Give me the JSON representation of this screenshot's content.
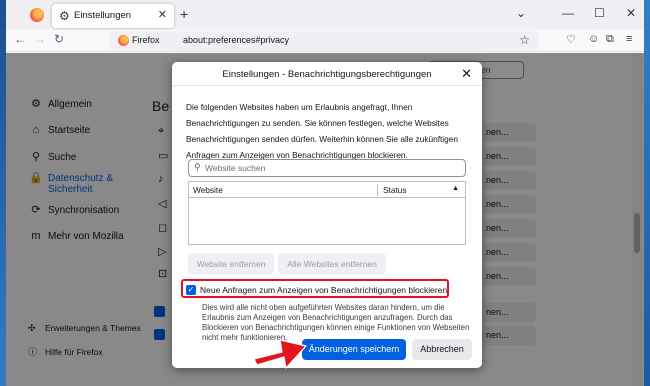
{
  "browser": {
    "tab_title": "Einstellungen",
    "new_tab_glyph": "+",
    "brand_label": "Firefox",
    "address": "about:preferences#privacy"
  },
  "preferences": {
    "search_placeholder": "chen",
    "heading_partial": "Be",
    "sidebar": [
      {
        "label": "Allgemein",
        "icon": "gear-icon"
      },
      {
        "label": "Startseite",
        "icon": "home-icon"
      },
      {
        "label": "Suche",
        "icon": "search-icon"
      },
      {
        "label": "Datenschutz &",
        "label2": "Sicherheit",
        "icon": "lock-icon",
        "active": true
      },
      {
        "label": "Synchronisation",
        "icon": "sync-icon"
      },
      {
        "label": "Mehr von Mozilla",
        "icon": "mozilla-icon"
      }
    ],
    "footer": [
      {
        "label": "Erweiterungen & Themes",
        "icon": "puzzle-icon"
      },
      {
        "label": "Hilfe für Firefox",
        "icon": "help-icon"
      }
    ],
    "row_button_partial": "nen..."
  },
  "dialog": {
    "title": "Einstellungen - Benachrichtigungsberechtigungen",
    "description": "Die folgenden Websites haben um Erlaubnis angefragt, Ihnen Benachrichtigungen zu senden. Sie können festlegen, welche Websites Benachrichtigungen senden dürfen. Weiterhin können Sie alle zukünftigen Anfragen zum Anzeigen von Benachrichtigungen blockieren.",
    "search_placeholder": "Website suchen",
    "col_website": "Website",
    "col_status": "Status",
    "remove_site": "Website entfernen",
    "remove_all": "Alle Websites entfernen",
    "block_checkbox_label": "Neue Anfragen zum Anzeigen von Benachrichtigungen blockieren",
    "block_checked": true,
    "block_description": "Dies wird alle nicht oben aufgeführten Websites daran hindern, um die Erlaubnis zum Anzeigen von Benachrichtigungen anzufragen. Durch das Blockieren von Benachrichtigungen können einige Funktionen von Webseiten nicht mehr funktionieren.",
    "save_label": "Änderungen speichern",
    "cancel_label": "Abbrechen"
  },
  "colors": {
    "accent": "#0061e0",
    "highlight": "#e3141d"
  }
}
